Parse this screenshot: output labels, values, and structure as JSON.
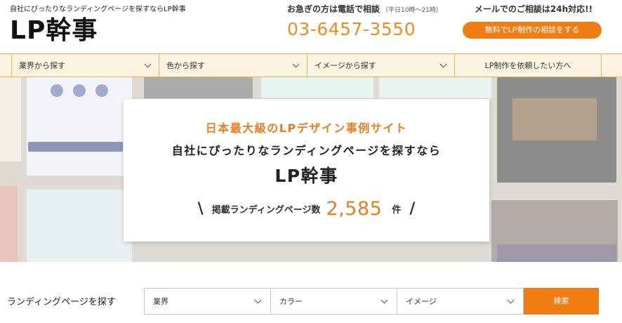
{
  "header": {
    "tagline": "自社にぴったりなランディングページを探すならLP幹事",
    "logo_text": "LP幹事",
    "phone_caption": "お急ぎの方は電話で相談",
    "phone_hours": "（平日10時〜21時）",
    "phone_number": "03-6457-3550",
    "mail_caption": "メールでのご相談は24h対応!!",
    "cta_label": "無料でLP制作の相談をする"
  },
  "nav": {
    "items": [
      {
        "label": "業界から探す"
      },
      {
        "label": "色から探す"
      },
      {
        "label": "イメージから探す"
      },
      {
        "label": "LP制作を依頼したい方へ"
      }
    ]
  },
  "hero": {
    "kicker": "日本最大級のLPデザイン事例サイト",
    "subtitle": "自社にぴったりなランディングページを探すなら",
    "title": "LP幹事",
    "count_prefix": "掲載ランディングページ数",
    "count_value": "2,585",
    "count_unit": "件",
    "slash_left": "\\",
    "slash_right": "/"
  },
  "search": {
    "label": "ランディングページを探す",
    "selects": [
      {
        "value": "業界"
      },
      {
        "value": "カラー"
      },
      {
        "value": "イメージ"
      }
    ],
    "button_label": "検索"
  },
  "colors": {
    "accent": "#f07d11",
    "nav_background": "#fdf3e1",
    "nav_border": "#f0b152"
  }
}
